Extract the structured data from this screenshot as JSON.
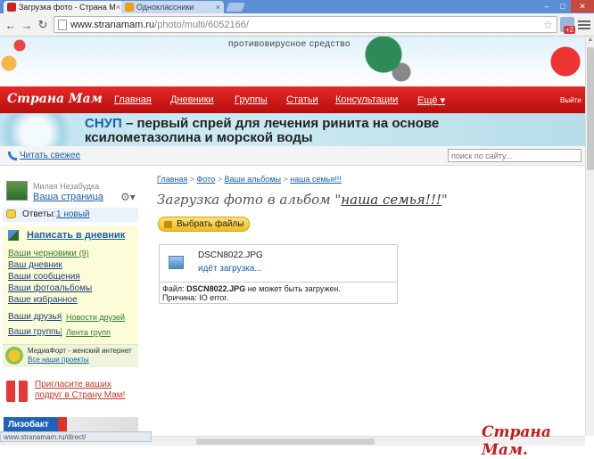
{
  "browser": {
    "tabs": [
      {
        "label": "Загрузка фото - Страна М",
        "active": true,
        "favicon_color": "#cc2222"
      },
      {
        "label": "Одноклассники",
        "active": false,
        "favicon_color": "#f39c12"
      }
    ],
    "url_host": "www.stranamam.ru",
    "url_path": "/photo/multi/6052166/",
    "extension_badge": "+2"
  },
  "header": {
    "tagline": "противовирусное средство",
    "logo": "Страна Мам",
    "nav": [
      "Главная",
      "Дневники",
      "Группы",
      "Статьи",
      "Консультации",
      "Ещё"
    ],
    "exit_label": "Выйти",
    "brand_color": "#d81d1d"
  },
  "ad": {
    "accent": "СНУП",
    "line1_rest": " – первый спрей для лечения ринита на основе",
    "line2": "ксилометазолина и морской воды"
  },
  "subbar": {
    "read_fresh": "Читать свежее",
    "search_placeholder": "поиск по сайту..."
  },
  "sidebar": {
    "user_title": "Милая Незабудка",
    "user_page": "Ваша страница",
    "answers_label": "Ответы:",
    "answers_new": "1 новый",
    "write_diary": "Написать в дневник",
    "drafts": "Ваши черновики",
    "drafts_count": "(9)",
    "links": [
      "Ваш дневник",
      "Ваши сообщения",
      "Ваши фотоальбомы",
      "Ваше избранное"
    ],
    "friends": "Ваши друзья",
    "friends_news": "Новости друзей",
    "groups": "Ваши группы",
    "groups_feed": "Лента групп",
    "medfort_text": "МедиаФорт - женский интернет",
    "medfort_link": "Все наши проекты",
    "invite": "Пригласите ваших подруг в Страну Мам!",
    "lizobakt": "Лизобакт"
  },
  "main": {
    "breadcrumb": [
      "Главная",
      "Фото",
      "Ваши альбомы",
      "наша семья!!!"
    ],
    "title_prefix": "Загрузка фото в альбом \"",
    "album_name": "наша семья!!!",
    "title_suffix": "\"",
    "select_files": "Выбрать файлы",
    "upload": {
      "filename": "DSCN8022.JPG",
      "status": "идёт загрузка...",
      "error_prefix": "Файл:",
      "error_file": "DSCN8022.JPG",
      "error_suffix": " не может быть загружен.",
      "reason_label": "Причина:",
      "reason": "IO error."
    }
  },
  "status_bar": "www.stranamam.ru/direct/",
  "watermark": "Страна Мам."
}
